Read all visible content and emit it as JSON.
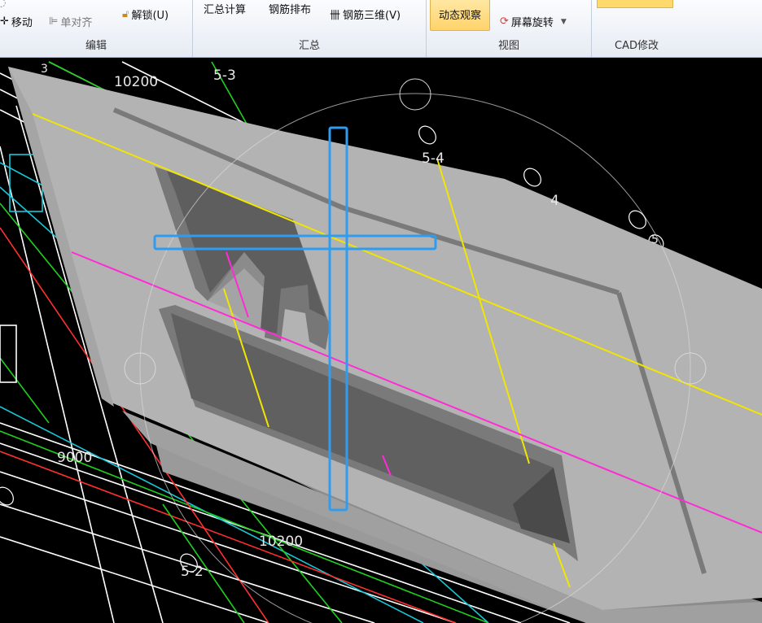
{
  "ribbon": {
    "edit_group": {
      "label": "编辑",
      "move": "移动",
      "align": "单对齐",
      "unlock": "解锁(U)"
    },
    "summary_group": {
      "label": "汇总",
      "summary_calc": "汇总计算",
      "rebar_layout": "钢筋排布",
      "rebar_3d": "钢筋三维(V)"
    },
    "view_group": {
      "label": "视图",
      "dynamic_view": "动态观察",
      "screen_rotate": "屏幕旋转"
    },
    "cad_group": {
      "label": "CAD修改"
    }
  },
  "viewport": {
    "dimensions": {
      "top": "10200",
      "left": "9000",
      "bottom": "10200"
    },
    "axis_labels": {
      "top": "5-3",
      "right_top": "5-4",
      "right": "4",
      "right_edge": "5",
      "bottom": "5-2",
      "left_top": "3"
    }
  },
  "colors": {
    "slab": "#b3b3b3",
    "slab_side": "#8c8c8c",
    "opening": "#5e5e5e",
    "cursor": "#2f9cf0",
    "axis_yellow": "#f2e600",
    "axis_magenta": "#ff2bd6"
  }
}
